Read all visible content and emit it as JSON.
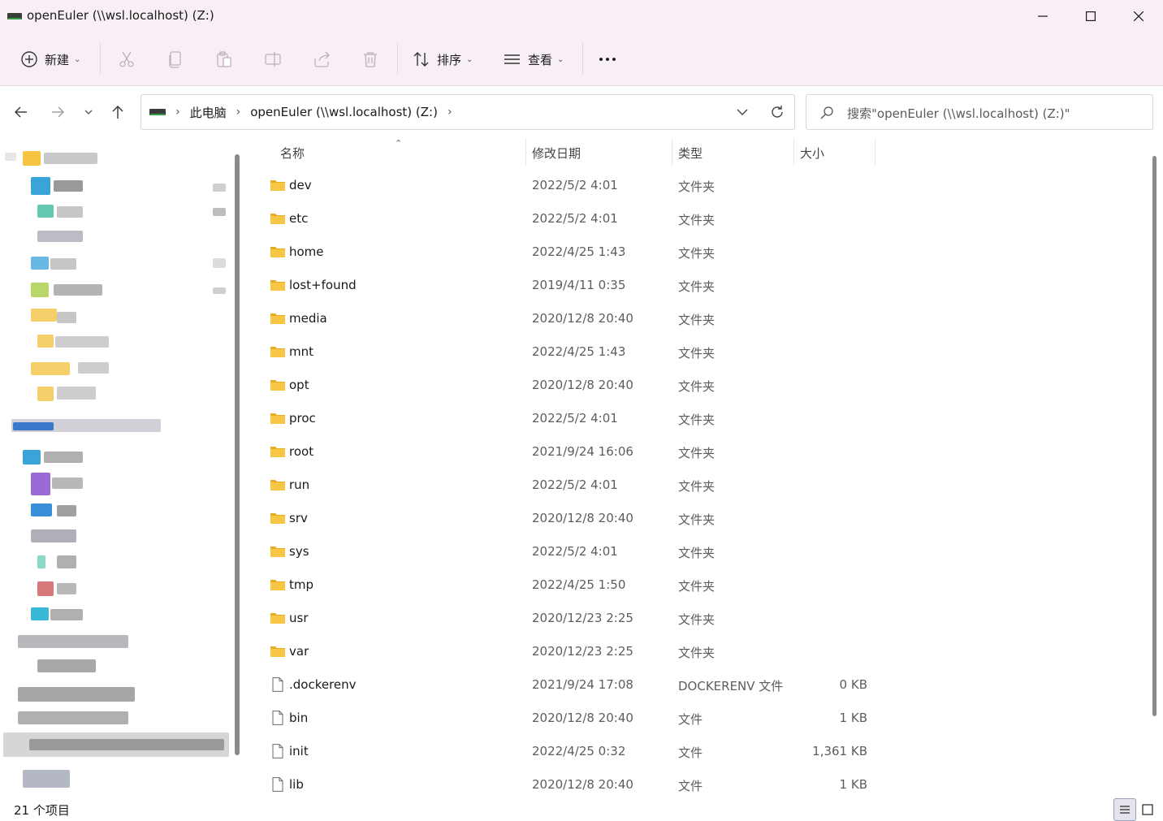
{
  "window": {
    "title": "openEuler (\\\\wsl.localhost) (Z:)",
    "minimize_icon": "minimize-icon",
    "maximize_icon": "maximize-icon",
    "close_icon": "close-icon"
  },
  "toolbar": {
    "new_label": "新建",
    "sort_label": "排序",
    "view_label": "查看",
    "icons": [
      "add-icon",
      "cut-icon",
      "copy-icon",
      "paste-icon",
      "rename-icon",
      "share-icon",
      "delete-icon",
      "sort-icon",
      "view-icon",
      "more-icon"
    ]
  },
  "nav": {
    "crumbs": [
      "此电脑",
      "openEuler (\\\\wsl.localhost) (Z:)"
    ],
    "search_placeholder": "搜索\"openEuler (\\\\wsl.localhost) (Z:)\""
  },
  "columns": {
    "name": "名称",
    "date": "修改日期",
    "type": "类型",
    "size": "大小"
  },
  "files": [
    {
      "name": "dev",
      "date": "2022/5/2 4:01",
      "type": "文件夹",
      "size": "",
      "kind": "folder"
    },
    {
      "name": "etc",
      "date": "2022/5/2 4:01",
      "type": "文件夹",
      "size": "",
      "kind": "folder"
    },
    {
      "name": "home",
      "date": "2022/4/25 1:43",
      "type": "文件夹",
      "size": "",
      "kind": "folder"
    },
    {
      "name": "lost+found",
      "date": "2019/4/11 0:35",
      "type": "文件夹",
      "size": "",
      "kind": "folder"
    },
    {
      "name": "media",
      "date": "2020/12/8 20:40",
      "type": "文件夹",
      "size": "",
      "kind": "folder"
    },
    {
      "name": "mnt",
      "date": "2022/4/25 1:43",
      "type": "文件夹",
      "size": "",
      "kind": "folder"
    },
    {
      "name": "opt",
      "date": "2020/12/8 20:40",
      "type": "文件夹",
      "size": "",
      "kind": "folder"
    },
    {
      "name": "proc",
      "date": "2022/5/2 4:01",
      "type": "文件夹",
      "size": "",
      "kind": "folder"
    },
    {
      "name": "root",
      "date": "2021/9/24 16:06",
      "type": "文件夹",
      "size": "",
      "kind": "folder"
    },
    {
      "name": "run",
      "date": "2022/5/2 4:01",
      "type": "文件夹",
      "size": "",
      "kind": "folder"
    },
    {
      "name": "srv",
      "date": "2020/12/8 20:40",
      "type": "文件夹",
      "size": "",
      "kind": "folder"
    },
    {
      "name": "sys",
      "date": "2022/5/2 4:01",
      "type": "文件夹",
      "size": "",
      "kind": "folder"
    },
    {
      "name": "tmp",
      "date": "2022/4/25 1:50",
      "type": "文件夹",
      "size": "",
      "kind": "folder"
    },
    {
      "name": "usr",
      "date": "2020/12/23 2:25",
      "type": "文件夹",
      "size": "",
      "kind": "folder"
    },
    {
      "name": "var",
      "date": "2020/12/23 2:25",
      "type": "文件夹",
      "size": "",
      "kind": "folder"
    },
    {
      "name": ".dockerenv",
      "date": "2021/9/24 17:08",
      "type": "DOCKERENV 文件",
      "size": "0 KB",
      "kind": "file"
    },
    {
      "name": "bin",
      "date": "2020/12/8 20:40",
      "type": "文件",
      "size": "1 KB",
      "kind": "file"
    },
    {
      "name": "init",
      "date": "2022/4/25 0:32",
      "type": "文件",
      "size": "1,361 KB",
      "kind": "file"
    },
    {
      "name": "lib",
      "date": "2020/12/8 20:40",
      "type": "文件",
      "size": "1 KB",
      "kind": "file"
    }
  ],
  "status": {
    "item_count": "21 个项目"
  },
  "colors": {
    "chrome_bg": "#f7eff5",
    "folder_yellow": "#f6c644",
    "folder_shade": "#e8ad1f"
  }
}
